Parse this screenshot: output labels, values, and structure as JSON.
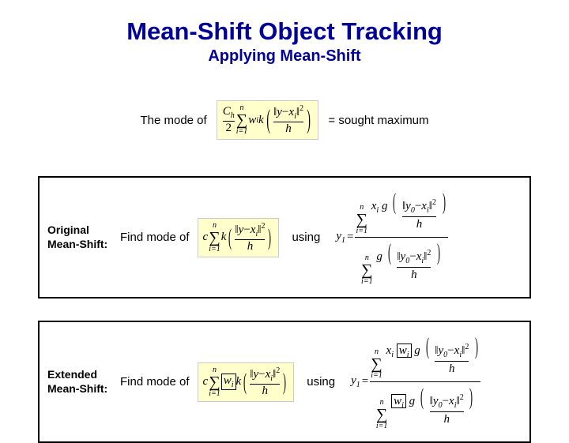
{
  "title": "Mean-Shift Object Tracking",
  "subtitle": "Applying Mean-Shift",
  "intro": {
    "left": "The mode of",
    "right": "=  sought maximum"
  },
  "rows": [
    {
      "label": "Original Mean-Shift:",
      "find": "Find mode of",
      "using": "using"
    },
    {
      "label": "Extended Mean-Shift:",
      "find": "Find mode of",
      "using": "using"
    }
  ],
  "formulas": {
    "intro_frac_top": "C",
    "intro_frac_top_sub": "h",
    "intro_frac_bot": "2",
    "sum_n": "n",
    "sum_i1": "i=1",
    "wi": "w",
    "wi_sub": "i",
    "k_fn": "k",
    "g_fn": "g",
    "c_const": "c",
    "y_var": "y",
    "y0": "y",
    "y0_sub": "0",
    "y1": "y",
    "y1_sub": "1",
    "xi": "x",
    "xi_sub": "i",
    "h_var": "h",
    "eq": "=",
    "minus": "−",
    "sq": "2"
  }
}
